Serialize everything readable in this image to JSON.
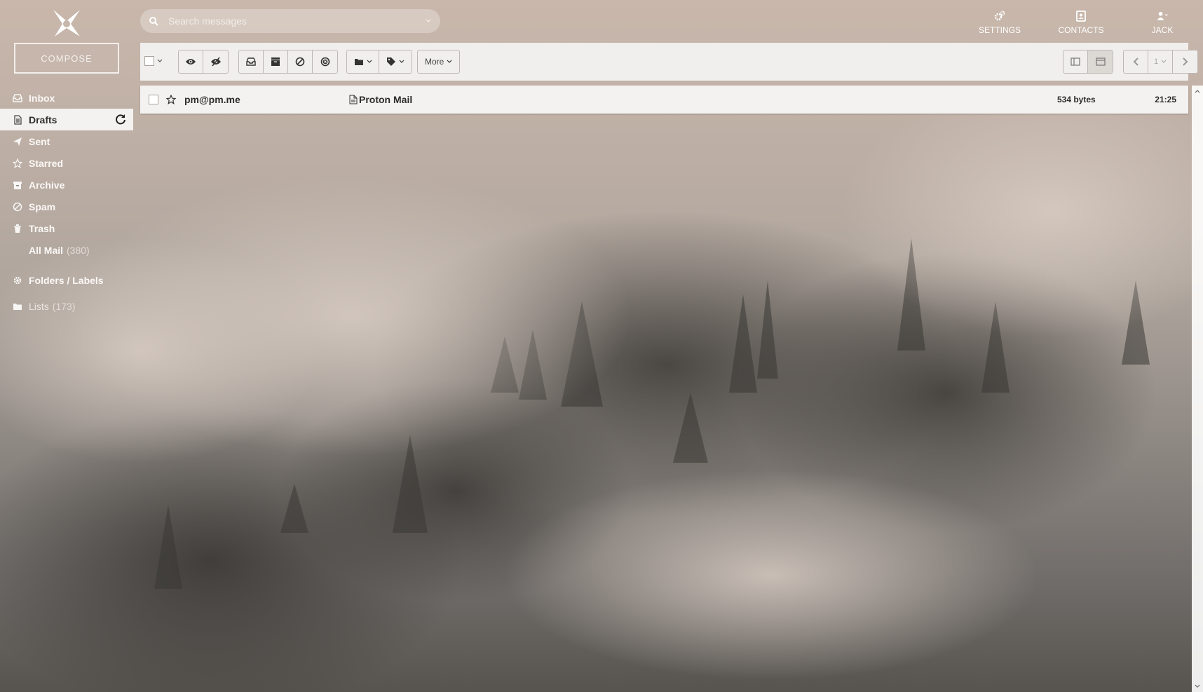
{
  "app": {
    "logo": "proton-logo"
  },
  "sidebar": {
    "compose_label": "COMPOSE",
    "items": [
      {
        "label": "Inbox",
        "icon": "inbox-icon"
      },
      {
        "label": "Drafts",
        "icon": "drafts-icon",
        "active": true
      },
      {
        "label": "Sent",
        "icon": "paper-plane-icon"
      },
      {
        "label": "Starred",
        "icon": "star-icon"
      },
      {
        "label": "Archive",
        "icon": "archive-icon"
      },
      {
        "label": "Spam",
        "icon": "ban-icon"
      },
      {
        "label": "Trash",
        "icon": "trash-icon"
      },
      {
        "label": "All Mail",
        "count": "(380)"
      }
    ],
    "folders_labels": "Folders / Labels",
    "lists_label": "Lists",
    "lists_count": "(173)"
  },
  "search": {
    "placeholder": "Search messages"
  },
  "topnav": {
    "settings": "SETTINGS",
    "contacts": "CONTACTS",
    "user": "JACK"
  },
  "toolbar": {
    "more_label": "More",
    "page_number": "1"
  },
  "messages": [
    {
      "from": "pm@pm.me",
      "subject": "Proton Mail",
      "size": "534 bytes",
      "time": "21:25"
    }
  ],
  "colors": {
    "accent": "#f4f2f0",
    "text_dark": "#2c2c2c"
  }
}
